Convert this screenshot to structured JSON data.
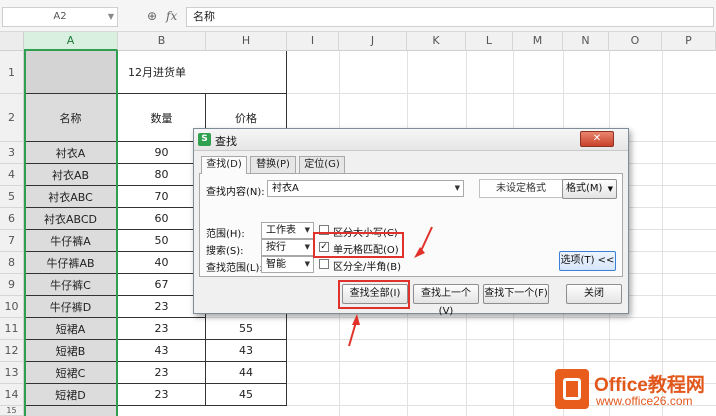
{
  "formula_bar": {
    "name_box": "A2",
    "zoom_icon": "zoom-icon",
    "fx_label": "fx",
    "content": "名称"
  },
  "columns": [
    "A",
    "B",
    "H",
    "I",
    "J",
    "K",
    "L",
    "M",
    "N",
    "O",
    "P"
  ],
  "rows": [
    "1",
    "2",
    "3",
    "4",
    "5",
    "6",
    "7",
    "8",
    "9",
    "10",
    "11",
    "12",
    "13",
    "14",
    "15"
  ],
  "sheet": {
    "title": "12月进货单",
    "header_name": "名称",
    "header_qty": "数量",
    "header_price": "价格",
    "names": [
      "衬衣A",
      "衬衣AB",
      "衬衣ABC",
      "衬衣ABCD",
      "牛仔裤A",
      "牛仔裤AB",
      "牛仔裤C",
      "牛仔裤D",
      "短裙A",
      "短裙B",
      "短裙C",
      "短裙D"
    ],
    "quantities": [
      "90",
      "80",
      "70",
      "60",
      "50",
      "40",
      "67",
      "23",
      "23",
      "43",
      "23",
      "23"
    ],
    "prices": [
      "55",
      "43",
      "44",
      "45"
    ]
  },
  "dialog": {
    "title": "查找",
    "tabs": [
      "查找(D)",
      "替换(P)",
      "定位(G)"
    ],
    "find_label": "查找内容(N):",
    "find_value": "衬衣A",
    "format_status": "未设定格式",
    "format_button": "格式(M)",
    "scope_label": "范围(H):",
    "scope_value": "工作表",
    "search_label": "搜索(S):",
    "search_value": "按行",
    "lookin_label": "查找范围(L):",
    "lookin_value": "智能",
    "match_case": "区分大小写(C)",
    "match_cell": "单元格匹配(O)",
    "match_width": "区分全/半角(B)",
    "options_button": "选项(T) <<",
    "find_all": "查找全部(I)",
    "find_prev": "查找上一个(V)",
    "find_next": "查找下一个(F)",
    "close": "关闭"
  },
  "watermark": {
    "title": "Office教程网",
    "url": "www.office26.com"
  },
  "colors": {
    "accent_green": "#2f9e4f",
    "highlight_red": "#e0322a",
    "brand_orange": "#e2571b"
  }
}
